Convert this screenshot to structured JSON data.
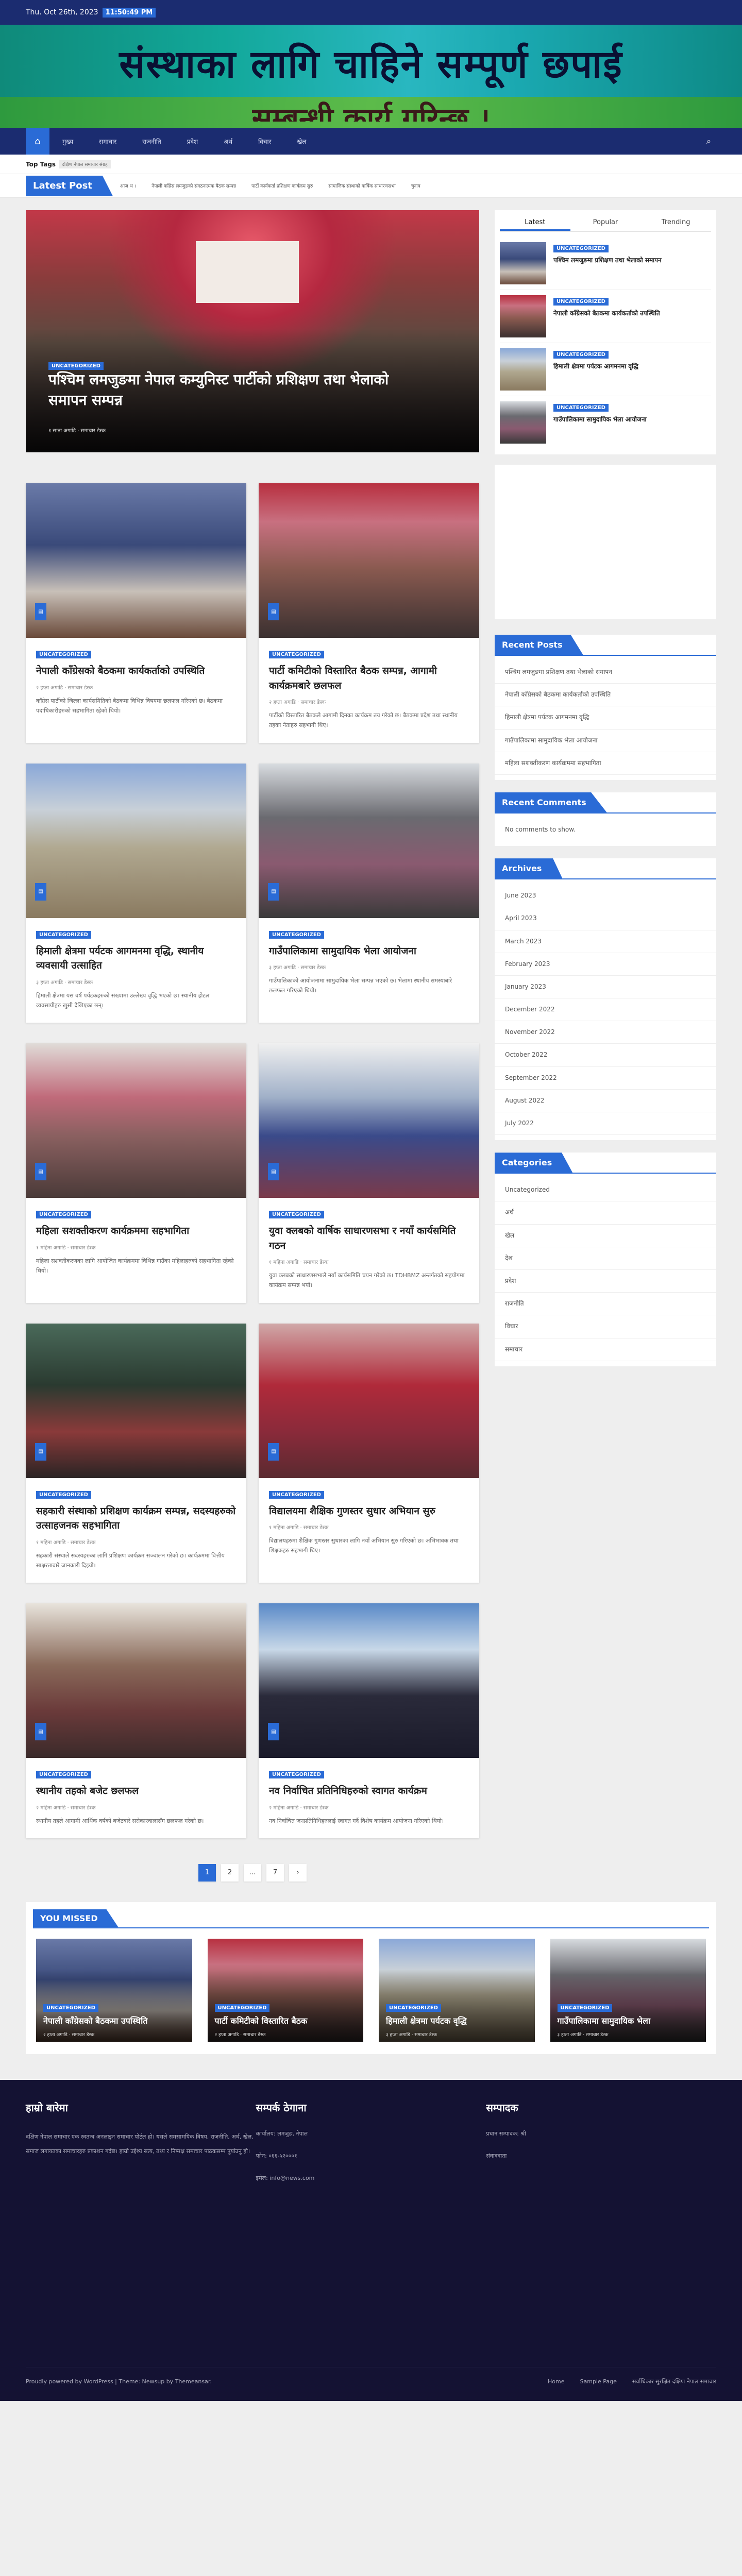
{
  "topbar": {
    "date": "Thu. Oct 26th, 2023",
    "time": "11:50:49 PM"
  },
  "banner": {
    "line1": "संस्थाका लागि चाहिने  सम्पूर्ण छपाई",
    "line2": "सम्बन्धी कार्य गरिन्छ ।"
  },
  "nav": {
    "home_icon": "home-icon",
    "items": [
      "मुख्य",
      "समाचार",
      "राजनीति",
      "प्रदेश",
      "अर्थ",
      "विचार",
      "खेल"
    ],
    "search_icon": "search-icon"
  },
  "tags": {
    "label": "Top Tags",
    "tag": "दक्षिण नेपाल समाचार संग्रह"
  },
  "ticker": {
    "label": "Latest Post",
    "items": [
      "आज भ ।",
      "नेपाली काँग्रेस लमजुङको संगठनात्मक बैठक सम्पन्न",
      "पार्टी कार्यकर्ता प्रशिक्षण कार्यक्रम सुरु",
      "सामाजिक संस्थाको वार्षिक साधारणसभा",
      "चुनाव"
    ]
  },
  "hero": {
    "category": "UNCATEGORIZED",
    "title": "पश्चिम लमजुङमा नेपाल कम्युनिस्ट पार्टीको प्रशिक्षण तथा भेलाको समापन सम्पन्न",
    "meta": "१ साता अगाडि  ·  समाचार डेस्क"
  },
  "cards": [
    {
      "category": "UNCATEGORIZED",
      "title": "नेपाली काँग्रेसको बैठकमा कार्यकर्ताको उपस्थिति",
      "meta": "२ हप्ता अगाडि  ·  समाचार डेस्क",
      "excerpt": "काँग्रेस पार्टीको जिल्ला कार्यसमितिको बैठकमा विभिन्न विषयमा छलफल गरिएको छ। बैठकमा पदाधिकारीहरुको सहभागिता रहेको थियो।",
      "img": "img-a"
    },
    {
      "category": "UNCATEGORIZED",
      "title": "पार्टी कमिटीको विस्तारित बैठक सम्पन्न, आगामी कार्यक्रमबारे छलफल",
      "meta": "२ हप्ता अगाडि  ·  समाचार डेस्क",
      "excerpt": "पार्टीको विस्तारित बैठकले आगामी दिनका कार्यक्रम तय गरेको छ। बैठकमा प्रदेश तथा स्थानीय तहका नेताहरु सहभागी थिए।",
      "img": "img-b"
    },
    {
      "category": "UNCATEGORIZED",
      "title": "हिमाली क्षेत्रमा पर्यटक आगमनमा वृद्धि, स्थानीय व्यवसायी उत्साहित",
      "meta": "३ हप्ता अगाडि  ·  समाचार डेस्क",
      "excerpt": "हिमाली क्षेत्रमा यस वर्ष पर्यटकहरुको संख्यामा उल्लेख्य वृद्धि भएको छ। स्थानीय होटल व्यवसायीहरु खुसी देखिएका छन्।",
      "img": "img-c"
    },
    {
      "category": "UNCATEGORIZED",
      "title": "गाउँपालिकामा सामुदायिक भेला आयोजना",
      "meta": "३ हप्ता अगाडि  ·  समाचार डेस्क",
      "excerpt": "गाउँपालिकाको आयोजनामा सामुदायिक भेला सम्पन्न भएको छ। भेलामा स्थानीय समस्याबारे छलफल गरिएको थियो।",
      "img": "img-d"
    },
    {
      "category": "UNCATEGORIZED",
      "title": "महिला सशक्तीकरण कार्यक्रममा सहभागिता",
      "meta": "१ महिना अगाडि  ·  समाचार डेस्क",
      "excerpt": "महिला सशक्तीकरणका लागि आयोजित कार्यक्रममा विभिन्न गाउँका महिलाहरुको सहभागिता रहेको थियो।",
      "img": "img-e"
    },
    {
      "category": "UNCATEGORIZED",
      "title": "युवा क्लबको वार्षिक साधारणसभा र नयाँ कार्यसमिति गठन",
      "meta": "१ महिना अगाडि  ·  समाचार डेस्क",
      "excerpt": "युवा क्लबको साधारणसभाले नयाँ कार्यसमिति चयन गरेको छ। TDHBMZ अन्तर्गतको सहयोगमा कार्यक्रम सम्पन्न भयो।",
      "img": "img-f"
    },
    {
      "category": "UNCATEGORIZED",
      "title": "सहकारी संस्थाको प्रशिक्षण कार्यक्रम सम्पन्न, सदस्यहरुको उत्साहजनक सहभागिता",
      "meta": "१ महिना अगाडि  ·  समाचार डेस्क",
      "excerpt": "सहकारी संस्थाले सदस्यहरुका लागि प्रशिक्षण कार्यक्रम सञ्चालन गरेको छ। कार्यक्रममा वित्तीय साक्षरताबारे जानकारी दिइयो।",
      "img": "img-g"
    },
    {
      "category": "UNCATEGORIZED",
      "title": "विद्यालयमा शैक्षिक गुणस्तर सुधार अभियान सुरु",
      "meta": "१ महिना अगाडि  ·  समाचार डेस्क",
      "excerpt": "विद्यालयहरुमा शैक्षिक गुणस्तर सुधारका लागि नयाँ अभियान सुरु गरिएको छ। अभिभावक तथा शिक्षकहरु सहभागी थिए।",
      "img": "img-h"
    },
    {
      "category": "UNCATEGORIZED",
      "title": "स्थानीय तहको बजेट छलफल",
      "meta": "२ महिना अगाडि  ·  समाचार डेस्क",
      "excerpt": "स्थानीय तहले आगामी आर्थिक वर्षको बजेटबारे सरोकारवालासँग छलफल गरेको छ।",
      "img": "img-i"
    },
    {
      "category": "UNCATEGORIZED",
      "title": "नव निर्वाचित प्रतिनिधिहरुको स्वागत कार्यक्रम",
      "meta": "२ महिना अगाडि  ·  समाचार डेस्क",
      "excerpt": "नव निर्वाचित जनप्रतिनिधिहरुलाई स्वागत गर्दै विशेष कार्यक्रम आयोजना गरिएको थियो।",
      "img": "img-j"
    }
  ],
  "pagination": [
    "1",
    "2",
    "…",
    "7",
    "›"
  ],
  "sidebar": {
    "tabs": [
      "Latest",
      "Popular",
      "Trending"
    ],
    "tab_posts": [
      {
        "category": "UNCATEGORIZED",
        "title": "पश्चिम लमजुङमा प्रशिक्षण तथा भेलाको समापन",
        "img": "img-a"
      },
      {
        "category": "UNCATEGORIZED",
        "title": "नेपाली काँग्रेसको बैठकमा कार्यकर्ताको उपस्थिति",
        "img": "img-b"
      },
      {
        "category": "UNCATEGORIZED",
        "title": "हिमाली क्षेत्रमा पर्यटक आगमनमा वृद्धि",
        "img": "img-c"
      },
      {
        "category": "UNCATEGORIZED",
        "title": "गाउँपालिकामा सामुदायिक भेला आयोजना",
        "img": "img-d"
      }
    ],
    "recent_posts_title": "Recent Posts",
    "recent_posts": [
      "पश्चिम लमजुङमा प्रशिक्षण तथा भेलाको समापन",
      "नेपाली काँग्रेसको बैठकमा कार्यकर्ताको उपस्थिति",
      "हिमाली क्षेत्रमा पर्यटक आगमनमा वृद्धि",
      "गाउँपालिकामा सामुदायिक भेला आयोजना",
      "महिला सशक्तीकरण कार्यक्रममा सहभागिता"
    ],
    "recent_comments_title": "Recent Comments",
    "recent_comments_text": "No comments to show.",
    "archives_title": "Archives",
    "archives": [
      "June 2023",
      "April 2023",
      "March 2023",
      "February 2023",
      "January 2023",
      "December 2022",
      "November 2022",
      "October 2022",
      "September 2022",
      "August 2022",
      "July 2022"
    ],
    "categories_title": "Categories",
    "categories": [
      "Uncategorized",
      "अर्थ",
      "खेल",
      "देश",
      "प्रदेश",
      "राजनीति",
      "विचार",
      "समाचार"
    ]
  },
  "missed": {
    "title": "YOU MISSED",
    "items": [
      {
        "category": "UNCATEGORIZED",
        "title": "नेपाली काँग्रेसको बैठकमा उपस्थिति",
        "meta": "२ हप्ता अगाडि  ·  समाचार डेस्क",
        "img": "img-a"
      },
      {
        "category": "UNCATEGORIZED",
        "title": "पार्टी कमिटीको विस्तारित बैठक",
        "meta": "२ हप्ता अगाडि  ·  समाचार डेस्क",
        "img": "img-b"
      },
      {
        "category": "UNCATEGORIZED",
        "title": "हिमाली क्षेत्रमा पर्यटक वृद्धि",
        "meta": "३ हप्ता अगाडि  ·  समाचार डेस्क",
        "img": "img-c"
      },
      {
        "category": "UNCATEGORIZED",
        "title": "गाउँपालिकामा सामुदायिक भेला",
        "meta": "३ हप्ता अगाडि  ·  समाचार डेस्क",
        "img": "img-d"
      }
    ]
  },
  "footer": {
    "col1_title": "हाम्रो बारेमा",
    "col1_text": "दक्षिण नेपाल समाचार एक स्वतन्त्र अनलाइन समाचार पोर्टल हो। यसले समसामयिक विषय, राजनीति, अर्थ, खेल, समाज लगायतका समाचारहरु प्रकाशन गर्दछ। हाम्रो उद्देश्य सत्य, तथ्य र निष्पक्ष समाचार पाठकसम्म पुर्याउनु हो।",
    "col2_title": "सम्पर्क ठेगाना",
    "col2_links": [
      "कार्यालय: लमजुङ, नेपाल",
      "फोन: ०६६-५२०००१",
      "इमेल: info@news.com"
    ],
    "col3_title": "सम्पादक",
    "col3_links": [
      "प्रधान सम्पादक: श्री",
      "संवाददाता"
    ],
    "bottom_left": "Proudly powered by WordPress | Theme: Newsup by Themeansar.",
    "bottom_links": [
      "Home",
      "Sample Page"
    ],
    "bottom_right": "सर्वाधिकार सुरक्षित दक्षिण नेपाल समाचार"
  }
}
